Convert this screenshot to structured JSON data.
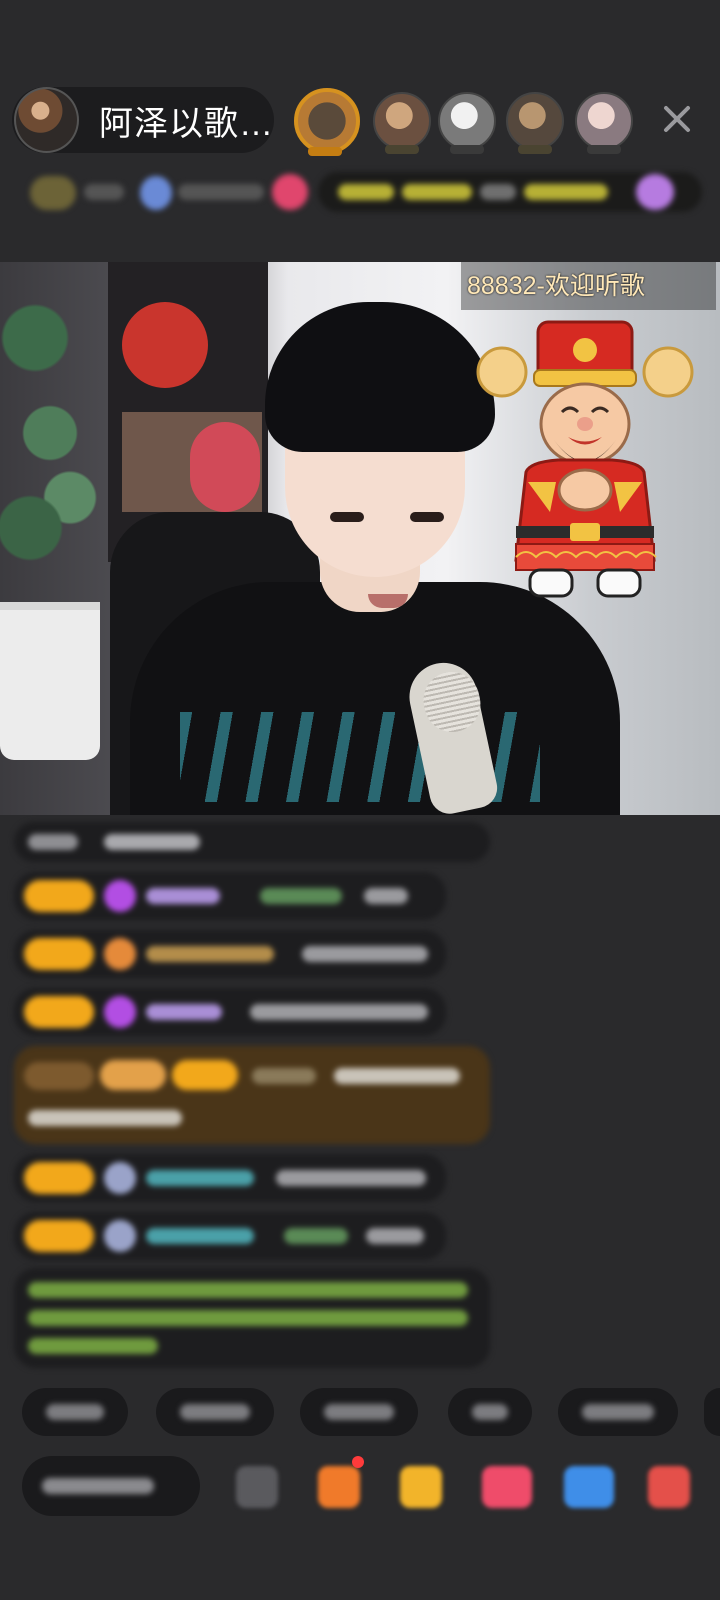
{
  "header": {
    "host_name": "阿泽以歌…",
    "close_icon": "close-icon"
  },
  "video": {
    "room_caption": "88832-欢迎听歌",
    "overlay_sticker": "fortune-god-sticker"
  },
  "colors": {
    "background": "#2a2a2c",
    "badge_gold": "#f2a81b",
    "chat_bubble": "#1d1d1f",
    "caption_text": "#ffe8b8"
  }
}
